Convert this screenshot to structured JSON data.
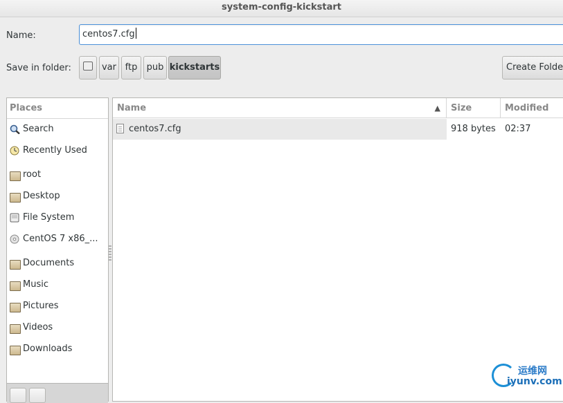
{
  "window": {
    "title": "system-config-kickstart"
  },
  "name_field": {
    "label": "Name:",
    "value": "centos7.cfg"
  },
  "folder": {
    "label": "Save in folder:",
    "crumbs": [
      "var",
      "ftp",
      "pub",
      "kickstarts"
    ],
    "active_crumb": "kickstarts",
    "create_folder_label": "Create Folder"
  },
  "places": {
    "header": "Places",
    "items": [
      {
        "label": "Search",
        "icon": "search-icon"
      },
      {
        "label": "Recently Used",
        "icon": "recent-clock-icon"
      },
      {
        "label": "root",
        "icon": "home-folder-icon"
      },
      {
        "label": "Desktop",
        "icon": "desktop-folder-icon"
      },
      {
        "label": "File System",
        "icon": "filesystem-icon"
      },
      {
        "label": "CentOS 7 x86_...",
        "icon": "optical-disc-icon"
      },
      {
        "label": "Documents",
        "icon": "documents-folder-icon"
      },
      {
        "label": "Music",
        "icon": "music-folder-icon"
      },
      {
        "label": "Pictures",
        "icon": "pictures-folder-icon"
      },
      {
        "label": "Videos",
        "icon": "videos-folder-icon"
      },
      {
        "label": "Downloads",
        "icon": "downloads-folder-icon"
      }
    ]
  },
  "files": {
    "columns": {
      "name": "Name",
      "size": "Size",
      "modified": "Modified"
    },
    "rows": [
      {
        "name": "centos7.cfg",
        "size": "918 bytes",
        "modified": "02:37"
      }
    ]
  },
  "watermark": {
    "cn": "运维网",
    "en": "iyunv.com"
  },
  "colors": {
    "accent": "#4a90d9",
    "selected_row": "#e9e9e9"
  }
}
